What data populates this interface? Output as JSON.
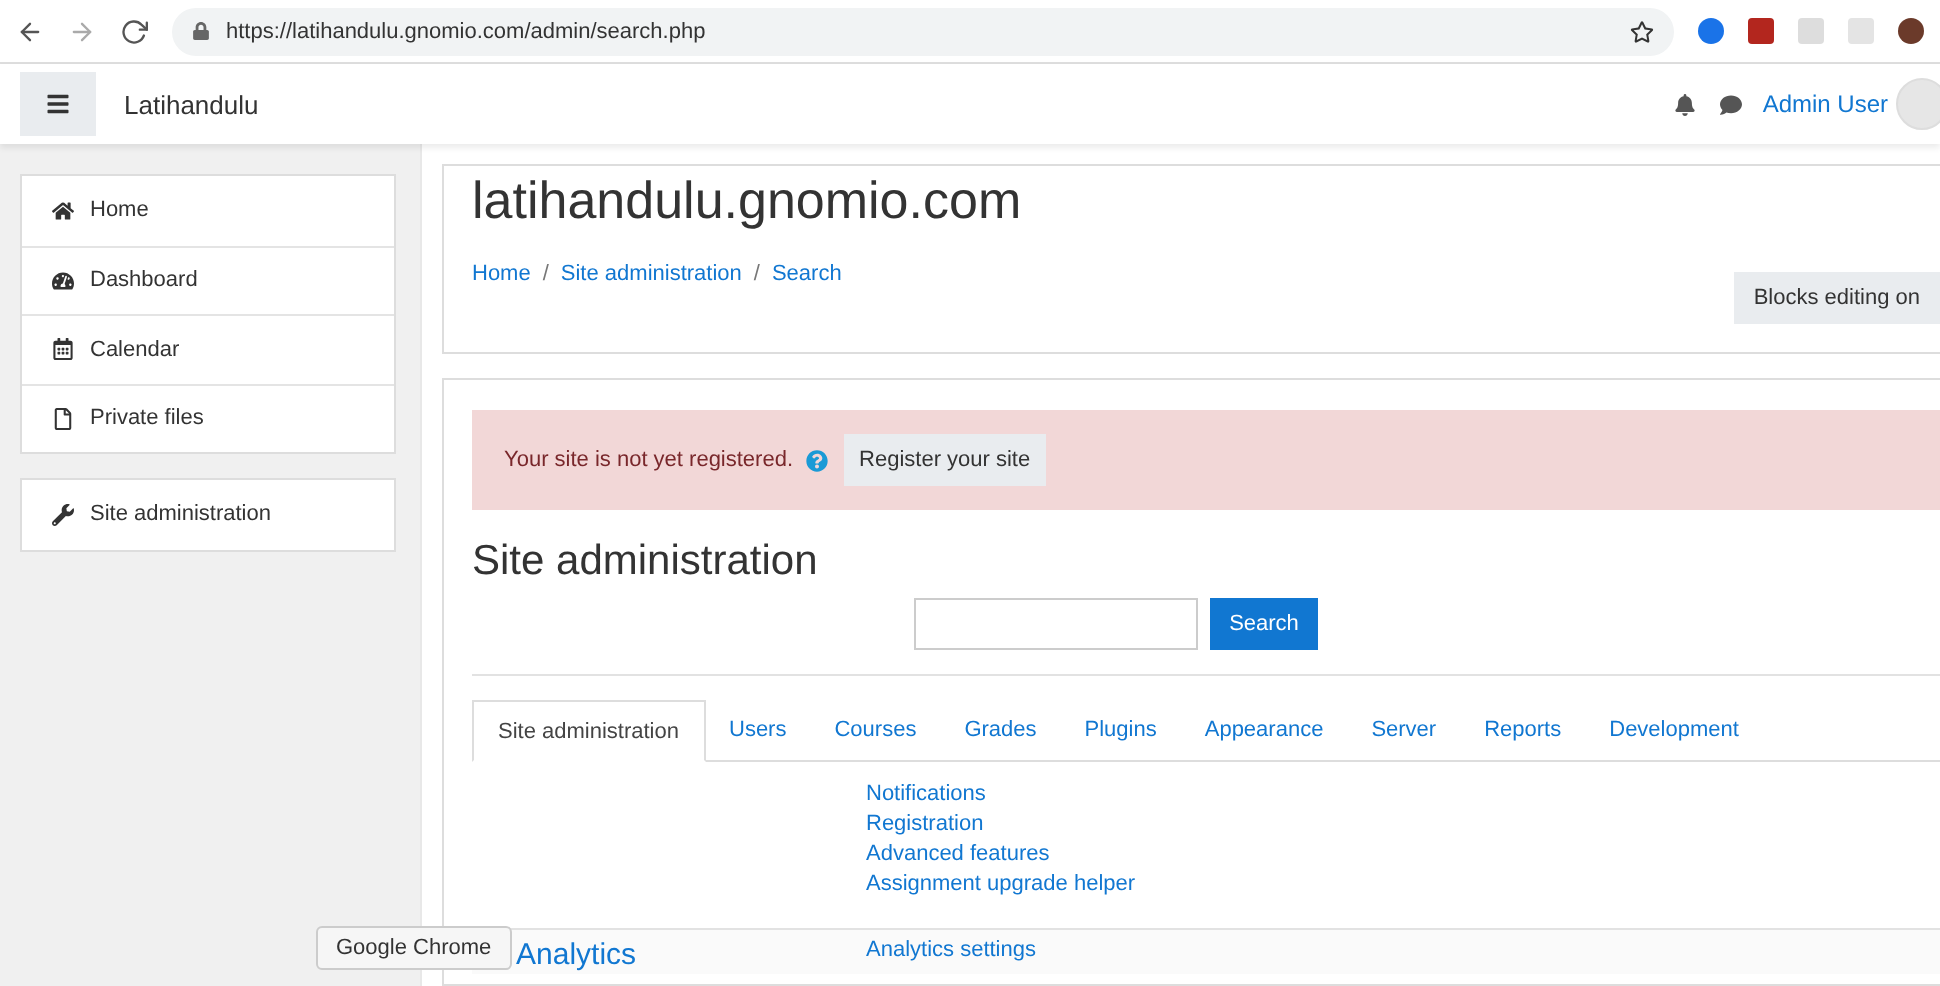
{
  "browser": {
    "url": "https://latihandulu.gnomio.com/admin/search.php"
  },
  "navbar": {
    "site_name": "Latihandulu",
    "user": "Admin User"
  },
  "sidebar": {
    "groups": [
      [
        {
          "label": "Home"
        },
        {
          "label": "Dashboard"
        },
        {
          "label": "Calendar"
        },
        {
          "label": "Private files"
        }
      ],
      [
        {
          "label": "Site administration"
        }
      ]
    ]
  },
  "header": {
    "title": "latihandulu.gnomio.com",
    "breadcrumbs": [
      "Home",
      "Site administration",
      "Search"
    ],
    "separator": "/",
    "button": "Blocks editing on"
  },
  "alert": {
    "text": "Your site is not yet registered.",
    "button": "Register your site"
  },
  "main": {
    "heading": "Site administration",
    "search_button": "Search",
    "tabs": [
      {
        "label": "Site administration",
        "selected": true
      },
      {
        "label": "Users",
        "selected": false
      },
      {
        "label": "Courses",
        "selected": false
      },
      {
        "label": "Grades",
        "selected": false
      },
      {
        "label": "Plugins",
        "selected": false
      },
      {
        "label": "Appearance",
        "selected": false
      },
      {
        "label": "Server",
        "selected": false
      },
      {
        "label": "Reports",
        "selected": false
      },
      {
        "label": "Development",
        "selected": false
      }
    ],
    "sections": [
      {
        "links": [
          "Notifications",
          "Registration",
          "Advanced features",
          "Assignment upgrade helper"
        ]
      },
      {
        "title": "Analytics",
        "links": [
          "Analytics settings"
        ]
      }
    ]
  },
  "tooltip": "Google Chrome"
}
